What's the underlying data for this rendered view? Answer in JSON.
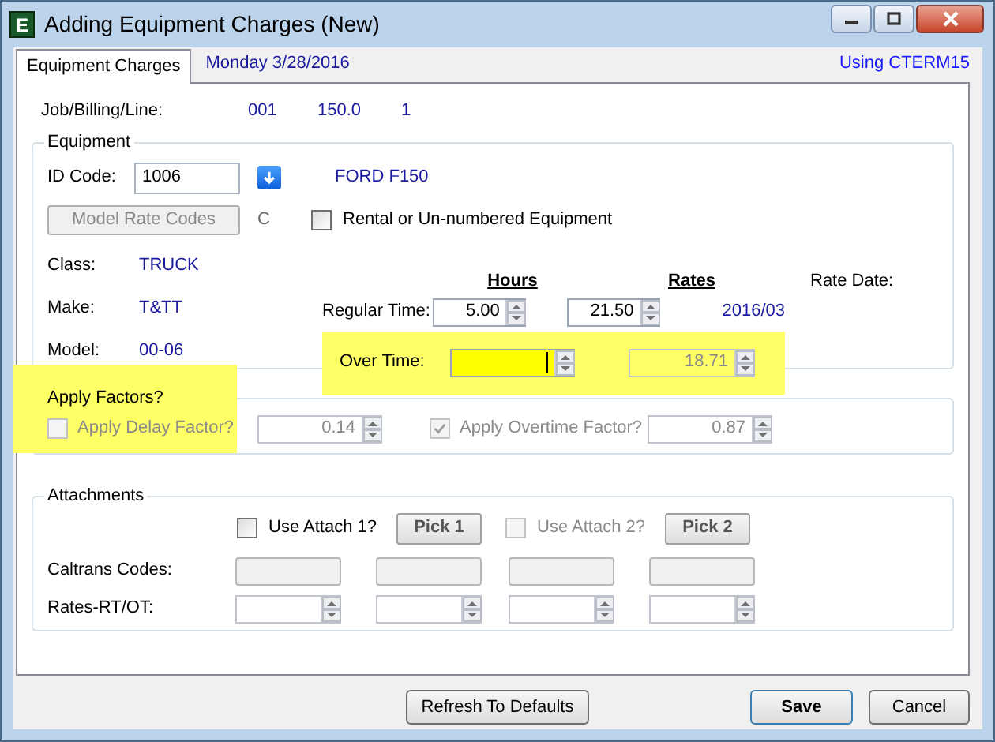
{
  "window": {
    "icon_letter": "E",
    "title": "Adding Equipment Charges  (New)"
  },
  "tabs": [
    {
      "label": "Equipment Charges",
      "selected": true
    }
  ],
  "header": {
    "date": "Monday  3/28/2016",
    "using": "Using CTERM15"
  },
  "job_billing_line": {
    "label": "Job/Billing/Line:",
    "values": [
      "001",
      "150.0",
      "1"
    ]
  },
  "equipment": {
    "legend": "Equipment",
    "id_code": {
      "label": "ID Code:",
      "value": "1006"
    },
    "equipment_name": "FORD F150",
    "model_rate_codes": {
      "label": "Model Rate Codes",
      "disabled": true
    },
    "code": "C",
    "rental": {
      "label": "Rental or Un-numbered Equipment",
      "checked": false
    },
    "info": [
      {
        "label": "Class:",
        "value": "TRUCK"
      },
      {
        "label": "Make:",
        "value": "T&TT"
      },
      {
        "label": "Model:",
        "value": "00-06"
      }
    ],
    "hours_header": "Hours",
    "rates_header": "Rates",
    "rate_date": {
      "label": "Rate Date:",
      "value": "2016/03"
    },
    "rows": [
      {
        "label": "Regular Time:",
        "hours": {
          "value": "5.00",
          "focused": false
        },
        "rate": {
          "value": "21.50",
          "disabled": false
        }
      },
      {
        "label": "Over Time:",
        "hours": {
          "focused": true
        },
        "rate": {
          "value": "18.71",
          "disabled": true
        },
        "highlighted": true
      }
    ]
  },
  "factors": {
    "legend": "Apply Factors?",
    "items": [
      {
        "label": "Apply Delay Factor?",
        "checked": false,
        "disabled": true,
        "value": "0.14",
        "highlighted": true
      },
      {
        "label": "Apply Overtime Factor?",
        "checked": true,
        "disabled": true,
        "value": "0.87"
      }
    ]
  },
  "attachments": {
    "legend": "Attachments",
    "uses": [
      {
        "label": "Use Attach 1?",
        "checked": false,
        "disabled": false,
        "pick": "Pick 1"
      },
      {
        "label": "Use Attach 2?",
        "checked": false,
        "disabled": true,
        "pick": "Pick 2"
      }
    ],
    "caltrans_label": "Caltrans Codes:",
    "rates_label": "Rates-RT/OT:"
  },
  "buttons": [
    {
      "label": "Refresh To Defaults",
      "default": false
    },
    {
      "label": "Save",
      "default": true
    },
    {
      "label": "Cancel",
      "default": false
    }
  ]
}
